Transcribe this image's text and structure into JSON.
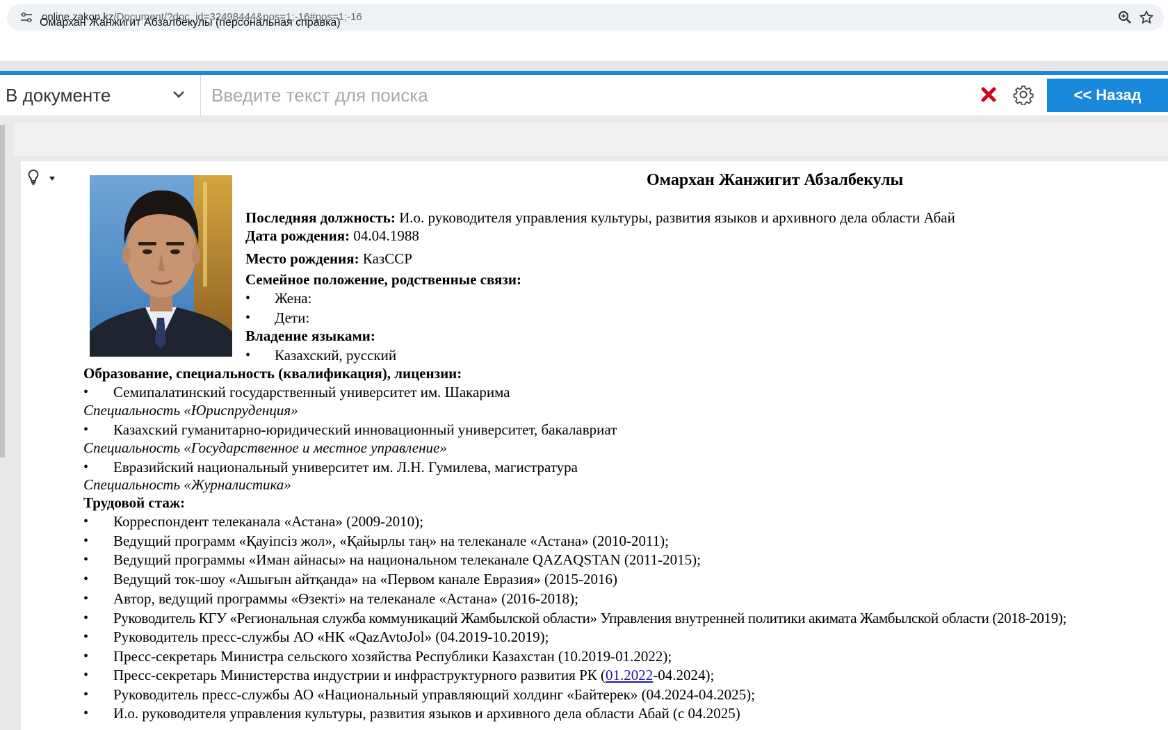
{
  "browser": {
    "url_host": "online.zakon.kz",
    "url_path": "/Document/?doc_id=32498444&pos=1;-16#pos=1;-16"
  },
  "toolbar": {
    "scope_label": "В документе",
    "search_placeholder": "Введите текст для поиска",
    "back_label": "<< Назад"
  },
  "colors": {
    "accent": "#1989dc",
    "clear_icon": "#d0021b",
    "link": "#1a1aa6"
  },
  "icons": [
    "site-info-icon",
    "zoom-icon",
    "star-icon",
    "chevron-down-icon",
    "close-icon",
    "gear-icon",
    "lightbulb-icon"
  ],
  "document": {
    "caption": "Омархан Жанжигит Абзалбекулы (персональная справка)",
    "name": "Омархан Жанжигит Абзалбекулы",
    "last_position_label": "Последняя должность:",
    "last_position_value": " И.о. руководителя управления культуры, развития языков и архивного дела области Абай",
    "birth_date_label": "Дата рождения:",
    "birth_date_value": " 04.04.1988",
    "birth_place_label": "Место рождения:",
    "birth_place_value": " КазССР",
    "family_label": "Семейное положение, родственные связи:",
    "family_items": [
      "Жена:",
      "Дети:"
    ],
    "languages_label": "Владение языками:",
    "languages_items": [
      "Казахский, русский"
    ],
    "education_label": "Образование, специальность (квалификация), лицензии:",
    "education": [
      {
        "institution": "Семипалатинский государственный университет им. Шакарима",
        "specialty": "Специальность «Юриспруденция»"
      },
      {
        "institution": "Казахский гуманитарно-юридический инновационный университет, бакалавриат",
        "specialty": "Специальность «Государственное и местное управление»"
      },
      {
        "institution": "Евразийский национальный университет им. Л.Н. Гумилева, магистратура",
        "specialty": "Специальность «Журналистика»"
      }
    ],
    "experience_label": "Трудовой стаж:",
    "experience": [
      "Корреспондент телеканала «Астана» (2009-2010);",
      "Ведущий программ «Қауіпсіз жол», «Қайырлы таң» на телеканале «Астана» (2010-2011);",
      "Ведущий программы «Иман айнасы» на национальном телеканале QAZAQSTAN (2011-2015);",
      "Ведущий ток-шоу «Ашығын айтқанда» на «Первом канале Евразия» (2015-2016)",
      "Автор, ведущий программы «Өзекті» на телеканале «Астана» (2016-2018);",
      "Руководитель КГУ «Региональная служба коммуникаций Жамбылской области» Управления внутренней политики акимата Жамбылской области (2018-2019);",
      "Руководитель пресс-службы АО «НК «QazAvtoJol» (04.2019-10.2019);",
      "Пресс-секретарь Министра сельского хозяйства Республики Казахстан (10.2019-01.2022);",
      "Руководитель пресс-службы АО «Национальный управляющий холдинг «Байтерек» (04.2024-04.2025);",
      "И.о. руководителя управления культуры, развития языков и архивного дела области Абай (с 04.2025)"
    ],
    "experience_linked": {
      "before": "Пресс-секретарь Министерства индустрии и инфраструктурного развития РК (",
      "link": "01.2022",
      "after": "-04.2024);"
    }
  }
}
